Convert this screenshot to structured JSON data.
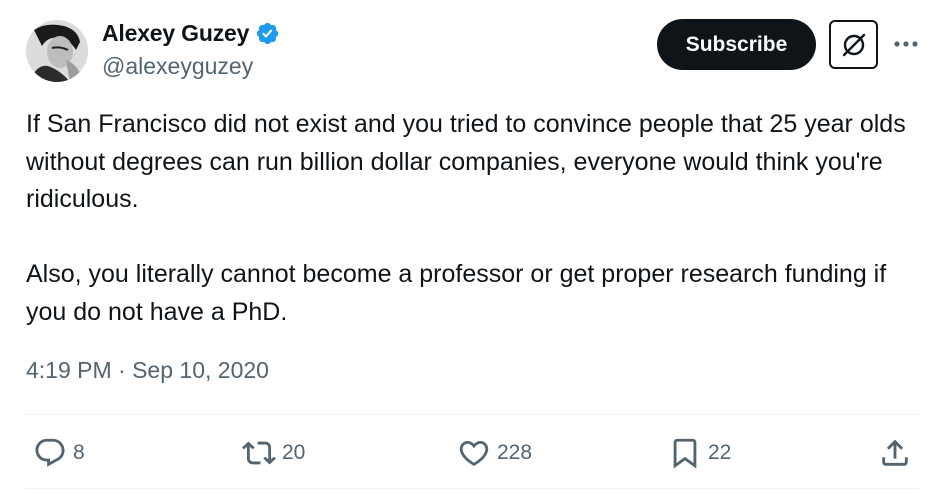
{
  "author": {
    "display_name": "Alexey Guzey",
    "handle": "@alexeyguzey",
    "verified_color": "#1d9bf0"
  },
  "header": {
    "subscribe_label": "Subscribe",
    "grok_icon": "grok-icon",
    "more_icon": "more-icon"
  },
  "tweet": {
    "text": "If San Francisco did not exist and you tried to convince people that 25 year olds without degrees can run billion dollar companies, everyone would think you're ridiculous.\n\nAlso, you literally cannot become a professor or get proper research funding if you do not have a PhD.",
    "timestamp": "4:19 PM · Sep 10, 2020"
  },
  "actions": {
    "replies": "8",
    "reposts": "20",
    "likes": "228",
    "bookmarks": "22"
  },
  "colors": {
    "text": "#0f1419",
    "secondary": "#536471",
    "divider": "#eff3f4",
    "button_bg": "#0f1419"
  }
}
